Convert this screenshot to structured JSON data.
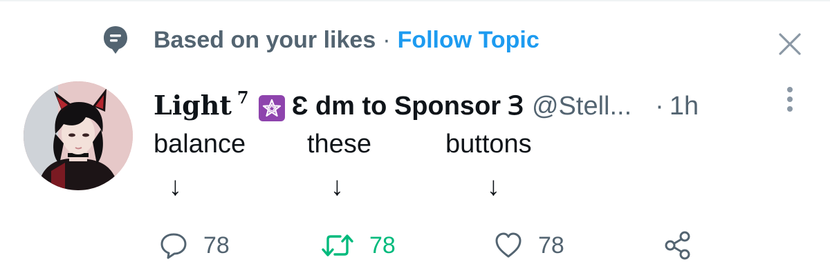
{
  "topic": {
    "context_text": "Based on your likes",
    "separator": "·",
    "follow_label": "Follow Topic",
    "close_icon": "close-icon"
  },
  "tweet": {
    "author": {
      "name": "Light",
      "superscript": "7",
      "name_suffix": "Ɛ dm to Sponsor Ɜ",
      "handle": "@Stell...",
      "badge_icon": "purple-star-emoji"
    },
    "separator": "·",
    "time": "1h",
    "body": {
      "words": [
        "balance",
        "these",
        "buttons"
      ],
      "arrow": "↓"
    },
    "actions": {
      "reply_count": "78",
      "retweet_count": "78",
      "like_count": "78"
    }
  },
  "colors": {
    "accent": "#1d9bf0",
    "muted": "#536471",
    "retweet_active": "#00ba7c",
    "badge": "#8e44ad"
  }
}
